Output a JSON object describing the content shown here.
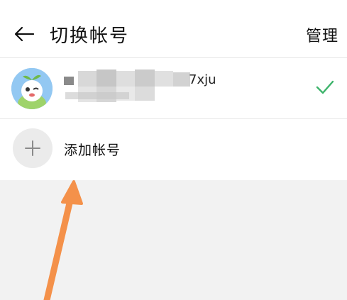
{
  "header": {
    "title": "切换帐号",
    "manage_label": "管理"
  },
  "accounts": [
    {
      "name_visible_suffix": "7xju",
      "selected": true
    }
  ],
  "add_account": {
    "label": "添加帐号"
  },
  "colors": {
    "check": "#3cb36a",
    "arrow": "#f4914a",
    "page_bg": "#f2f2f2"
  },
  "icons": {
    "back": "arrow-left-icon",
    "check": "checkmark-icon",
    "add": "plus-icon",
    "annotation": "orange-pointer-arrow"
  }
}
